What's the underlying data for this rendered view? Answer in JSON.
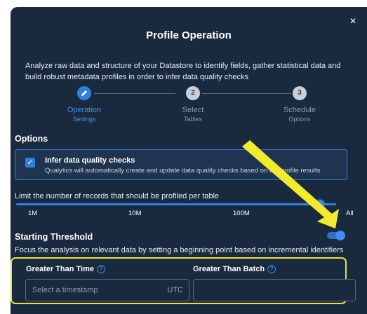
{
  "dialog": {
    "title": "Profile Operation",
    "description": "Analyze raw data and structure of your Datastore to identify fields, gather statistical data and build robust metadata profiles in order to infer data quality checks",
    "close_glyph": "×"
  },
  "stepper": {
    "steps": [
      {
        "number": "",
        "label": "Operation",
        "sublabel": "Settings",
        "state": "active"
      },
      {
        "number": "2",
        "label": "Select",
        "sublabel": "Tables",
        "state": "todo"
      },
      {
        "number": "3",
        "label": "Schedule",
        "sublabel": "Options",
        "state": "todo"
      }
    ]
  },
  "options": {
    "title": "Options",
    "infer_checks": {
      "checked": true,
      "title": "Infer data quality checks",
      "subtitle": "Qualytics will automatically create and update data quality checks based on the profile results"
    },
    "limit": {
      "label": "Limit the number of records that should be profiled per table",
      "ticks": [
        "1M",
        "10M",
        "100M",
        "All"
      ],
      "selected": "All"
    }
  },
  "threshold": {
    "title": "Starting Threshold",
    "enabled": true,
    "description": "Focus the analysis on relevant data by setting a beginning point based on incremental identifiers",
    "time_field": {
      "label": "Greater Than Time",
      "placeholder": "Select a timestamp",
      "unit": "UTC",
      "value": ""
    },
    "batch_field": {
      "label": "Greater Than Batch",
      "placeholder": "",
      "value": ""
    }
  },
  "colors": {
    "dialog_bg": "#1a2a3e",
    "accent": "#2f7fe0",
    "highlight": "#e8e23a"
  }
}
